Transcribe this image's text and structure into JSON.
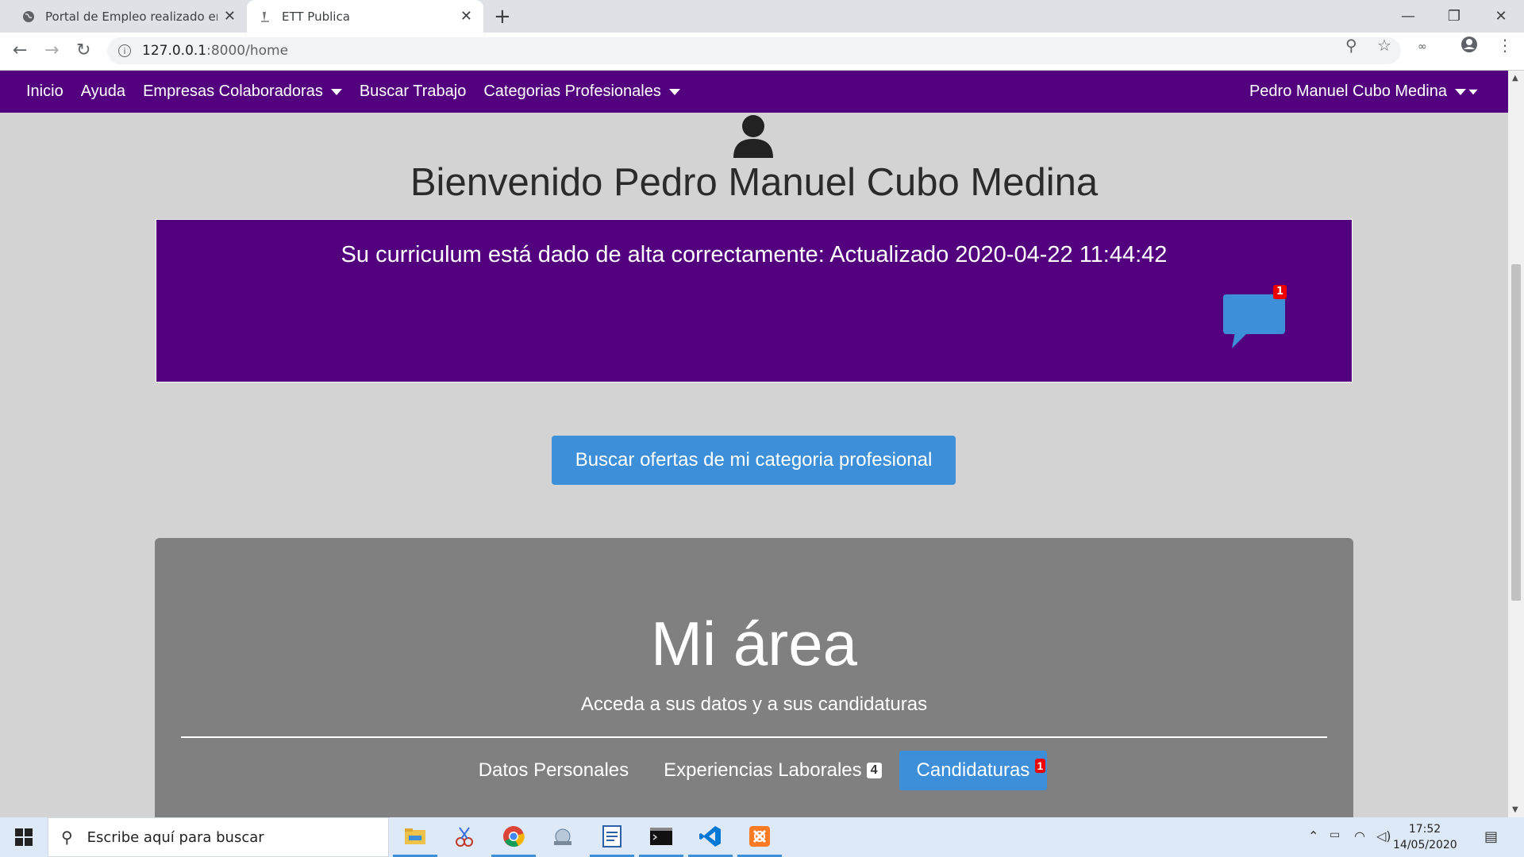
{
  "browser": {
    "tabs": [
      {
        "title": "Portal de Empleo realizado en La"
      },
      {
        "title": "ETT Publica"
      }
    ],
    "url_host": "127.0.0.1",
    "url_path": ":8000/home"
  },
  "navbar": {
    "items": [
      "Inicio",
      "Ayuda",
      "Empresas Colaboradoras",
      "Buscar Trabajo",
      "Categorias Profesionales"
    ],
    "user": "Pedro Manuel Cubo Medina"
  },
  "welcome": "Bienvenido Pedro Manuel Cubo Medina",
  "cv_status": "Su curriculum está dado de alta correctamente: Actualizado 2020-04-22 11:44:42",
  "messages_badge": "1",
  "search_button": "Buscar ofertas de mi categoria profesional",
  "area": {
    "title": "Mi área",
    "subtitle": "Acceda a sus datos y a sus candidaturas",
    "tabs": [
      {
        "label": "Datos Personales"
      },
      {
        "label": "Experiencias Laborales",
        "badge": "4"
      },
      {
        "label": "Candidaturas",
        "badge": "1"
      }
    ]
  },
  "taskbar": {
    "search_placeholder": "Escribe aquí para buscar",
    "time": "17:52",
    "date": "14/05/2020"
  },
  "colors": {
    "navbar": "#52007e",
    "primary_button": "#3d8fd9",
    "area_card": "#808080",
    "badge_red": "#ee0000"
  }
}
